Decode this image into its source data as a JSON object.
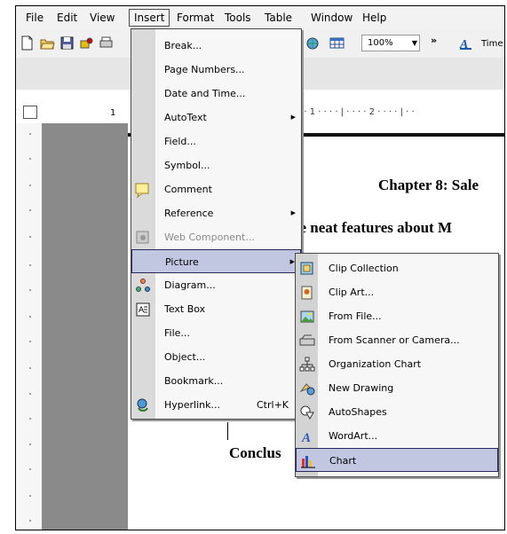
{
  "menubar": {
    "items": [
      {
        "label": "File"
      },
      {
        "label": "Edit"
      },
      {
        "label": "View"
      },
      {
        "label": "Insert"
      },
      {
        "label": "Format"
      },
      {
        "label": "Tools"
      },
      {
        "label": "Table"
      },
      {
        "label": "Window"
      },
      {
        "label": "Help"
      }
    ]
  },
  "toolbar": {
    "zoom": "100%",
    "font": "Time"
  },
  "ruler": {
    "left_mark": "1",
    "marks": "· · 1 · · · · | · · · · 2 · · · · | · ·"
  },
  "document": {
    "chapter": "Chapter 8: Sale",
    "subtitle": "he neat features about M",
    "conclusion": "Conclus"
  },
  "insert_menu": {
    "items": [
      {
        "label": "Break...",
        "shortcut": "",
        "disabled": false
      },
      {
        "label": "Page Numbers...",
        "shortcut": "",
        "disabled": false
      },
      {
        "label": "Date and Time...",
        "shortcut": "",
        "disabled": false
      },
      {
        "label": "AutoText",
        "shortcut": "",
        "disabled": false
      },
      {
        "label": "Field...",
        "shortcut": "",
        "disabled": false
      },
      {
        "label": "Symbol...",
        "shortcut": "",
        "disabled": false
      },
      {
        "label": "Comment",
        "shortcut": "",
        "disabled": false
      },
      {
        "label": "Reference",
        "shortcut": "",
        "disabled": false
      },
      {
        "label": "Web Component...",
        "shortcut": "",
        "disabled": true
      },
      {
        "label": "Picture",
        "shortcut": "",
        "disabled": false
      },
      {
        "label": "Diagram...",
        "shortcut": "",
        "disabled": false
      },
      {
        "label": "Text Box",
        "shortcut": "",
        "disabled": false
      },
      {
        "label": "File...",
        "shortcut": "",
        "disabled": false
      },
      {
        "label": "Object...",
        "shortcut": "",
        "disabled": false
      },
      {
        "label": "Bookmark...",
        "shortcut": "",
        "disabled": false
      },
      {
        "label": "Hyperlink...",
        "shortcut": "Ctrl+K",
        "disabled": false
      }
    ]
  },
  "picture_submenu": {
    "items": [
      {
        "label": "Clip Collection"
      },
      {
        "label": "Clip Art..."
      },
      {
        "label": "From File..."
      },
      {
        "label": "From Scanner or Camera..."
      },
      {
        "label": "Organization Chart"
      },
      {
        "label": "New Drawing"
      },
      {
        "label": "AutoShapes"
      },
      {
        "label": "WordArt..."
      },
      {
        "label": "Chart"
      }
    ]
  },
  "colors": {
    "highlight": "#c1c7e1",
    "highlight_border": "#2a2a5a",
    "gray_margin": "#8a8a8a"
  }
}
